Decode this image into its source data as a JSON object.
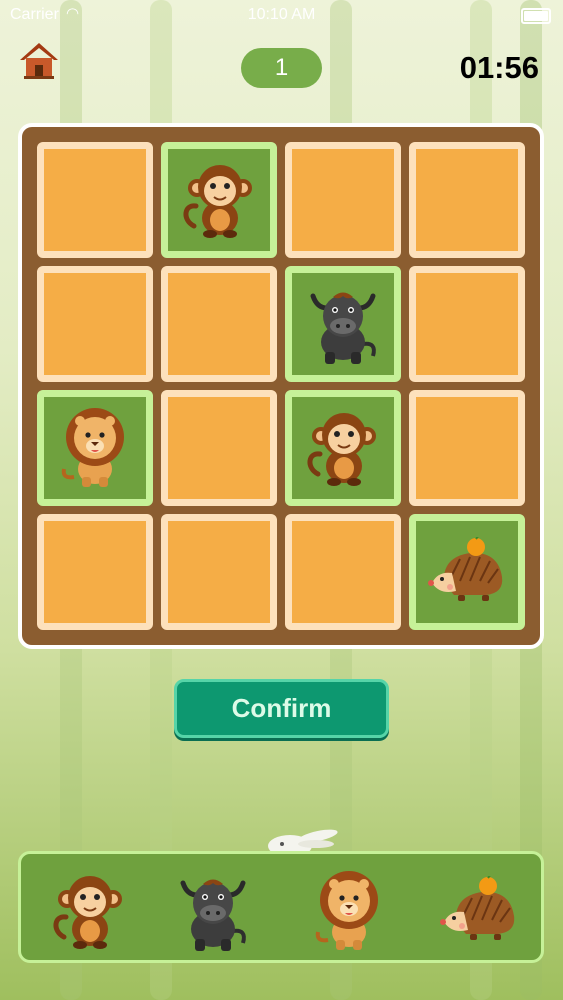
{
  "status_bar": {
    "carrier": "Carrier",
    "time": "10:10 AM"
  },
  "header": {
    "home_icon": "home-icon",
    "round": "1",
    "timer": "01:56"
  },
  "board": {
    "tiles": [
      {
        "state": "hidden"
      },
      {
        "state": "revealed",
        "animal": "monkey"
      },
      {
        "state": "hidden"
      },
      {
        "state": "hidden"
      },
      {
        "state": "hidden"
      },
      {
        "state": "hidden"
      },
      {
        "state": "revealed",
        "animal": "bull"
      },
      {
        "state": "hidden"
      },
      {
        "state": "revealed",
        "animal": "lion"
      },
      {
        "state": "hidden"
      },
      {
        "state": "revealed",
        "animal": "monkey"
      },
      {
        "state": "hidden"
      },
      {
        "state": "hidden"
      },
      {
        "state": "hidden"
      },
      {
        "state": "hidden"
      },
      {
        "state": "revealed",
        "animal": "hedgehog"
      }
    ]
  },
  "confirm_label": "Confirm",
  "tray": {
    "animals": [
      "monkey",
      "bull",
      "lion",
      "hedgehog"
    ]
  },
  "colors": {
    "board_frame": "#8b5d30",
    "tile_hidden": "#f5ad46",
    "tile_revealed": "#6fa13e",
    "confirm": "#0d9870"
  }
}
